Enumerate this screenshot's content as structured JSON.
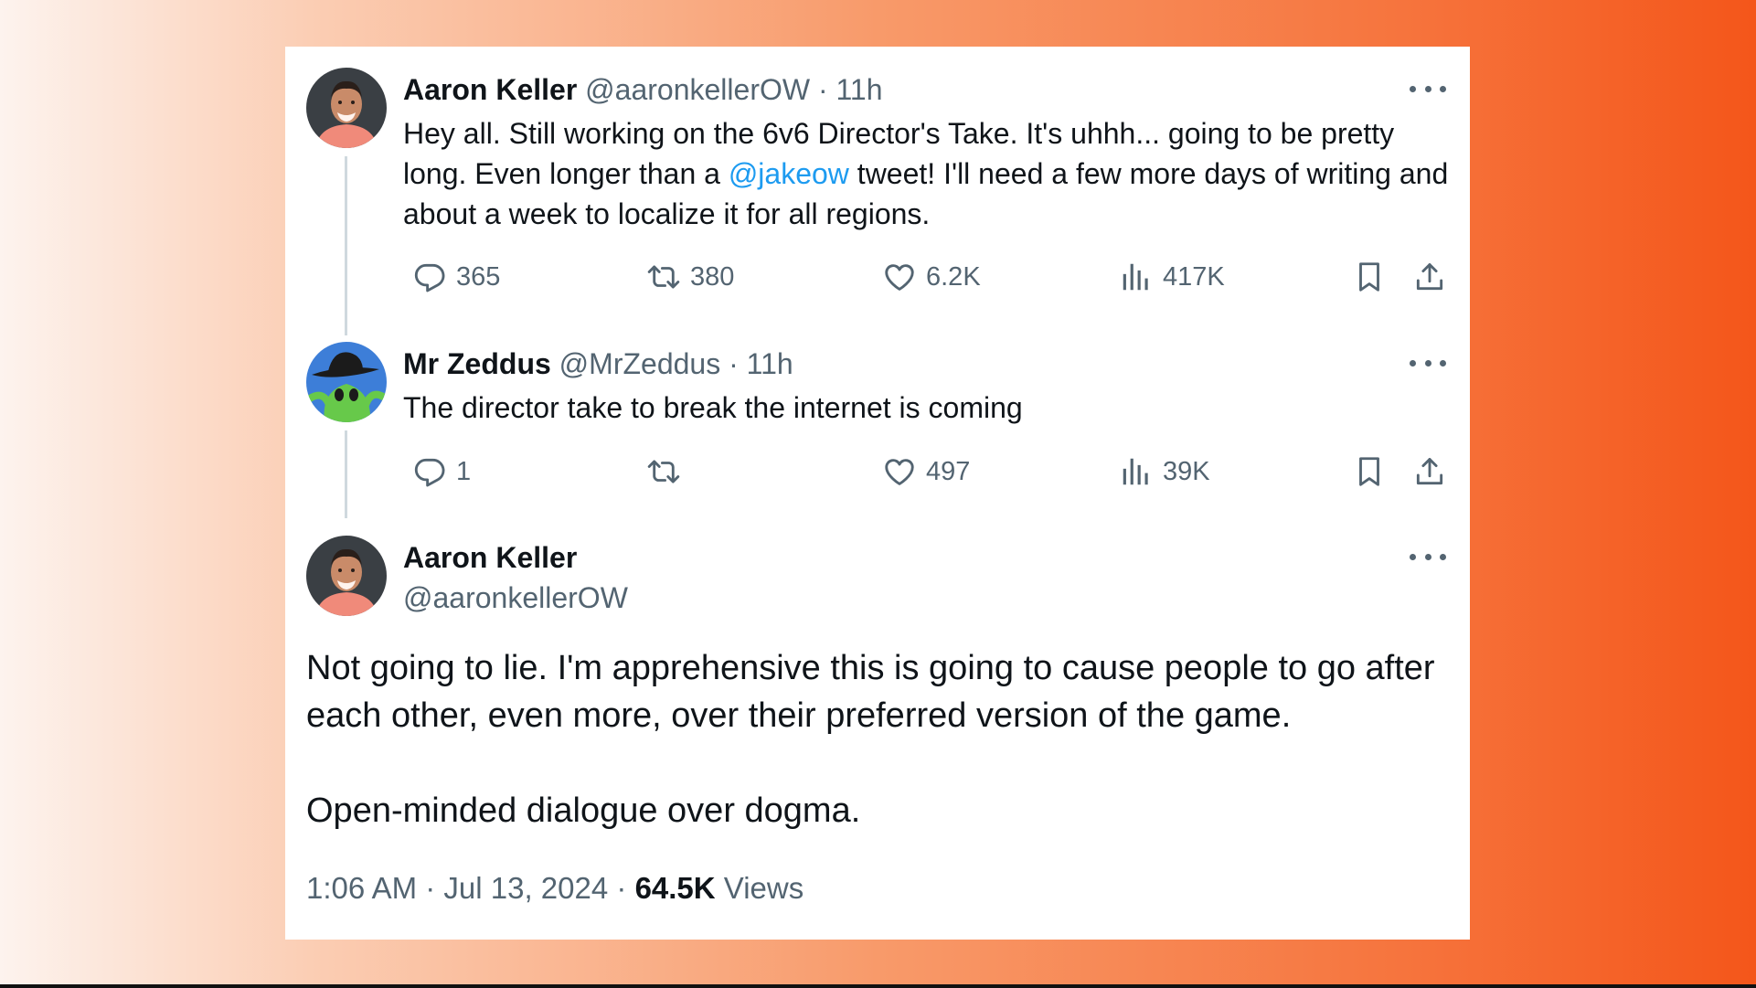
{
  "thread": {
    "tweet1": {
      "author_name": "Aaron Keller",
      "handle": "@aaronkellerOW",
      "time": "11h",
      "text_before": "Hey all. Still working on the 6v6 Director's Take. It's uhhh... going to be pretty long. Even longer than a ",
      "mention": "@jakeow",
      "text_after": " tweet! I'll need a few more days of writing and about a week to localize it for all regions.",
      "replies": "365",
      "reposts": "380",
      "likes": "6.2K",
      "views": "417K"
    },
    "tweet2": {
      "author_name": "Mr Zeddus",
      "handle": "@MrZeddus",
      "time": "11h",
      "text": "The director take to break the internet is coming",
      "replies": "1",
      "likes": "497",
      "views": "39K"
    },
    "main": {
      "author_name": "Aaron Keller",
      "handle": "@aaronkellerOW",
      "paragraph1_line1": "Not going to lie. I'm apprehensive this is going to cause people to go after",
      "paragraph1_line2": "each other, even more, over their preferred version of the game.",
      "paragraph2": "Open-minded dialogue over dogma.",
      "timestamp": "1:06 AM · Jul 13, 2024",
      "views_count": "64.5K",
      "views_label": "Views"
    }
  },
  "icons": [
    "reply-icon",
    "repost-icon",
    "like-icon",
    "views-icon",
    "bookmark-icon",
    "share-icon",
    "more-icon"
  ],
  "colors": {
    "text": "#0f1419",
    "secondary": "#536471",
    "link": "#1d9bf0"
  }
}
